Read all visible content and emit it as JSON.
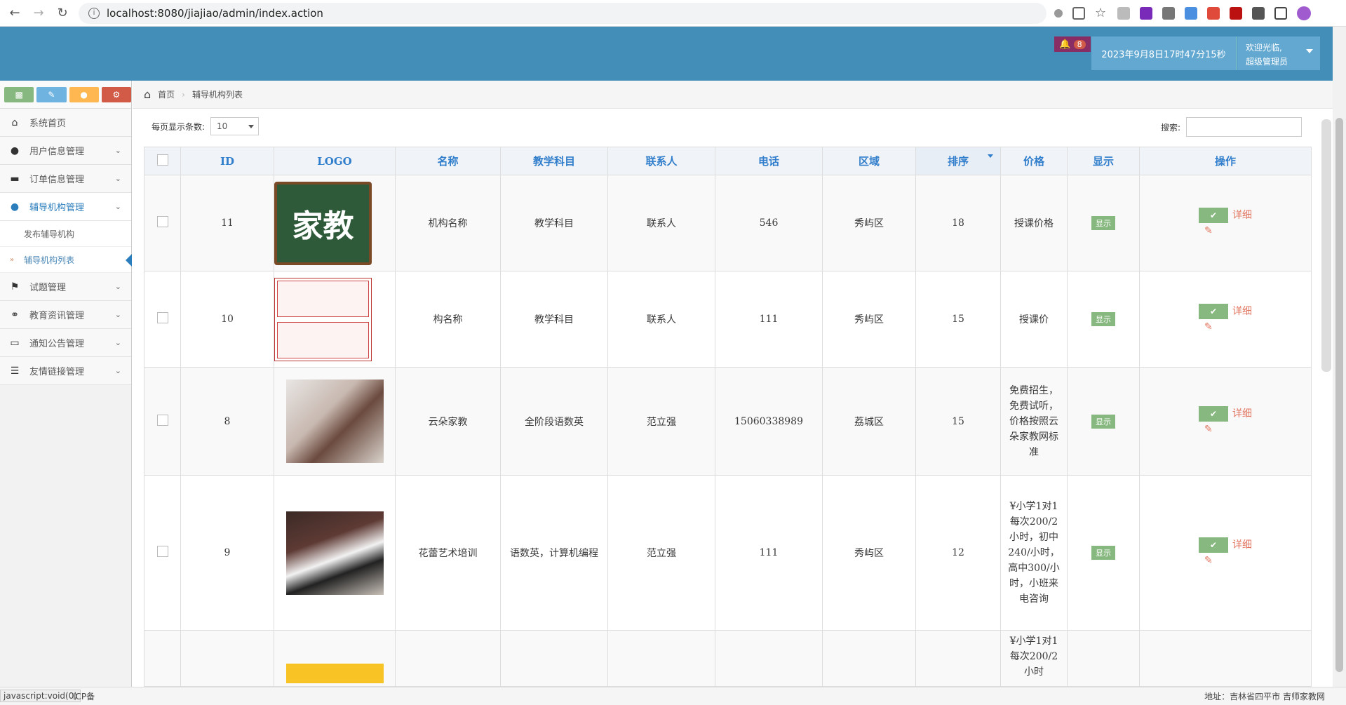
{
  "browser": {
    "url": "localhost:8080/jiajiao/admin/index.action"
  },
  "header": {
    "notification_count": "8",
    "datetime": "2023年9月8日17时47分15秒",
    "welcome": "欢迎光临,",
    "role": "超级管理员"
  },
  "sidebar": {
    "items": [
      {
        "label": "系统首页",
        "icon": "home-icon"
      },
      {
        "label": "用户信息管理",
        "icon": "user-icon"
      },
      {
        "label": "订单信息管理",
        "icon": "card-icon"
      },
      {
        "label": "辅导机构管理",
        "icon": "user-icon"
      },
      {
        "label": "试题管理",
        "icon": "bookmark-icon"
      },
      {
        "label": "教育资讯管理",
        "icon": "chat-icon"
      },
      {
        "label": "通知公告管理",
        "icon": "monitor-icon"
      },
      {
        "label": "友情链接管理",
        "icon": "list-icon"
      }
    ],
    "subitems": [
      {
        "label": "发布辅导机构"
      },
      {
        "label": "辅导机构列表"
      }
    ]
  },
  "breadcrumb": {
    "home": "首页",
    "current": "辅导机构列表"
  },
  "table_controls": {
    "page_size_label": "每页显示条数:",
    "page_size": "10",
    "search_label": "搜索:"
  },
  "table": {
    "headers": [
      "ID",
      "LOGO",
      "名称",
      "教学科目",
      "联系人",
      "电话",
      "区域",
      "排序",
      "价格",
      "显示",
      "操作"
    ],
    "rows": [
      {
        "id": "11",
        "name": "机构名称",
        "subject": "教学科目",
        "contact": "联系人",
        "phone": "546",
        "area": "秀屿区",
        "sort": "18",
        "price": "授课价格",
        "show": "显示",
        "logo_text": "家教"
      },
      {
        "id": "10",
        "name": "构名称",
        "subject": "教学科目",
        "contact": "联系人",
        "phone": "111",
        "area": "秀屿区",
        "sort": "15",
        "price": "授课价",
        "show": "显示",
        "logo_text": ""
      },
      {
        "id": "8",
        "name": "云朵家教",
        "subject": "全阶段语数英",
        "contact": "范立强",
        "phone": "15060338989",
        "area": "荔城区",
        "sort": "15",
        "price": "免费招生，免费试听，价格按照云朵家教网标准",
        "show": "显示",
        "logo_text": ""
      },
      {
        "id": "9",
        "name": "花蕾艺术培训",
        "subject": "语数英，计算机编程",
        "contact": "范立强",
        "phone": "111",
        "area": "秀屿区",
        "sort": "12",
        "price": "¥小学1对1每次200/2小时，初中240/小时，高中300/小时，小班来电咨询",
        "show": "显示",
        "logo_text": ""
      },
      {
        "id": "",
        "name": "",
        "subject": "",
        "contact": "",
        "phone": "",
        "area": "",
        "sort": "",
        "price": "¥小学1对1每次200/2小时",
        "show": "",
        "logo_text": ""
      }
    ],
    "ops_detail": "详细"
  },
  "statusbar": {
    "left": "javascript:void(0)",
    "left_tail": "ICP备",
    "right": "地址：吉林省四平市 吉师家教网"
  }
}
